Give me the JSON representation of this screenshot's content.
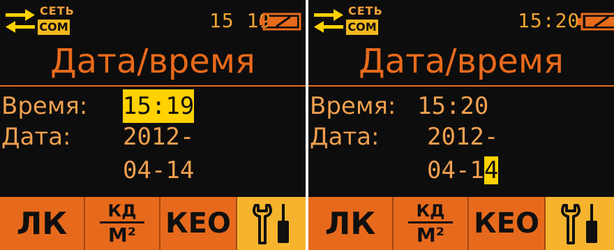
{
  "left_screen": {
    "status": {
      "network_label": "СЕТЬ",
      "com_label": "COM",
      "time": "15 19"
    },
    "title": "Дата/время",
    "time_label": "Время:",
    "time_value": "15:19",
    "date_label": "Дата:",
    "date_value": "2012-04-14",
    "softkeys": {
      "lk": "ЛК",
      "kd_top": "КД",
      "kd_bottom": "М²",
      "keo": "КЕО"
    }
  },
  "right_screen": {
    "status": {
      "network_label": "СЕТЬ",
      "com_label": "COM",
      "time": "15:20"
    },
    "title": "Дата/время",
    "time_label": "Время:",
    "time_value": "15:20",
    "date_label": "Дата:",
    "date_value_prefix": "2012-04-1",
    "date_value_caret": "4",
    "softkeys": {
      "lk": "ЛК",
      "kd_top": "КД",
      "kd_bottom": "М²",
      "keo": "КЕО"
    }
  },
  "colors": {
    "background": "#0d0d0d",
    "accent": "#e86a1b",
    "highlight": "#ffd200",
    "softkey": "#e76a1c",
    "tools_key": "#f6b42e"
  }
}
